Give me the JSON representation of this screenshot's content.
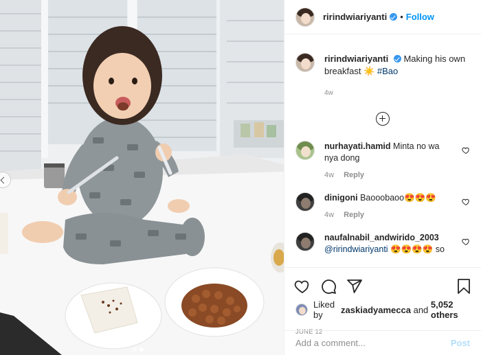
{
  "post": {
    "username": "ririndwiariyanti",
    "follow_label": "Follow",
    "separator": "•",
    "caption_text": "Making his own breakfast ☀️",
    "caption_hashtag": "#Bao",
    "caption_time": "4w"
  },
  "comments": [
    {
      "username": "nurhayati.hamid",
      "text": "Minta no wa nya dong",
      "time": "4w",
      "reply_label": "Reply"
    },
    {
      "username": "dinigoni",
      "text": "Baooobaoo😍😍😍",
      "time": "4w",
      "reply_label": "Reply"
    },
    {
      "username": "naufalnabil_andwirido_2003",
      "mention": "@ririndwiariyanti",
      "text": "😍😍😍😍 so",
      "time": "",
      "reply_label": ""
    }
  ],
  "likes": {
    "prefix": "Liked by",
    "user": "zaskiadyamecca",
    "and": "and",
    "count": "5,052 others"
  },
  "post_date": "JUNE 12",
  "comment_box": {
    "placeholder": "Add a comment...",
    "post_label": "Post"
  },
  "colors": {
    "link": "#00376b",
    "follow": "#0095f6",
    "verified": "#3897f0",
    "muted": "#8e8e8e"
  },
  "icons": [
    "verified-badge-icon",
    "load-more-icon",
    "heart-icon",
    "comment-icon",
    "share-icon",
    "bookmark-icon"
  ],
  "carousel": {
    "slides": 2,
    "active": 2
  }
}
